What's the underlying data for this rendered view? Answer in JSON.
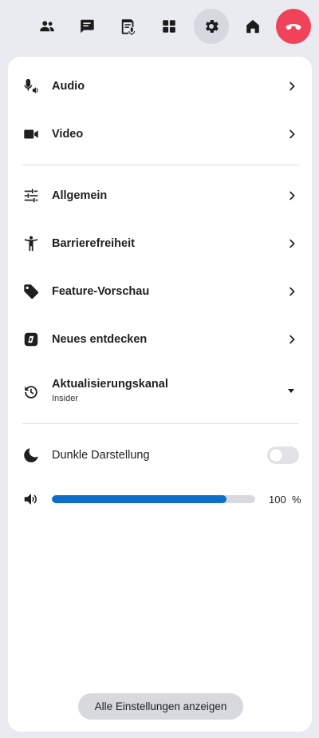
{
  "toolbar": {
    "buttons": [
      {
        "icon": "people-icon",
        "name": "people-button"
      },
      {
        "icon": "chat-icon",
        "name": "chat-button"
      },
      {
        "icon": "transcript-icon",
        "name": "transcript-button"
      },
      {
        "icon": "apps-icon",
        "name": "apps-button"
      },
      {
        "icon": "gear-icon",
        "name": "settings-button",
        "active": true
      },
      {
        "icon": "home-icon",
        "name": "home-button"
      },
      {
        "icon": "hang-up-icon",
        "name": "hang-up-button"
      }
    ],
    "hangup_color": "#f0435a"
  },
  "settings": {
    "audio_label": "Audio",
    "video_label": "Video",
    "general_label": "Allgemein",
    "accessibility_label": "Barrierefreiheit",
    "preview_label": "Feature-Vorschau",
    "discover_label": "Neues entdecken",
    "channel_label": "Aktualisierungskanal",
    "channel_value": "Insider",
    "dark_mode_label": "Dunkle Darstellung",
    "dark_mode_on": false,
    "volume_value": "100",
    "volume_unit": "%",
    "volume_fraction": 0.86,
    "volume_color": "#0f6ec8",
    "all_settings_label": "Alle Einstellungen anzeigen"
  }
}
